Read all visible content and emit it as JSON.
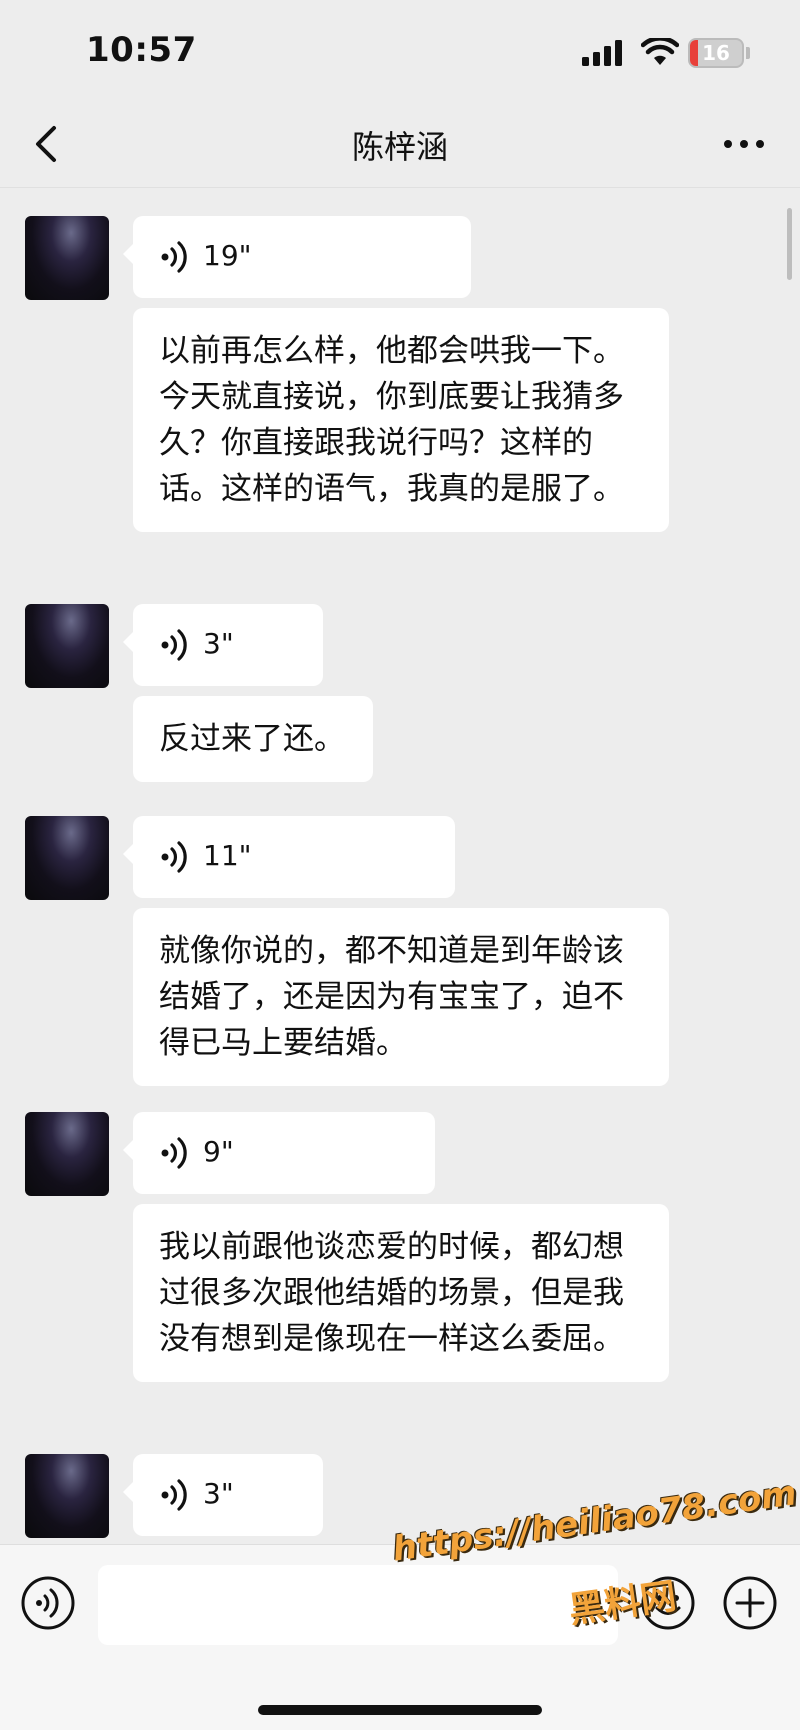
{
  "status_bar": {
    "time": "10:57",
    "battery_level": "16",
    "battery_color": "#e8403a",
    "icons": [
      "cellular-signal-icon",
      "wifi-icon",
      "battery-icon"
    ]
  },
  "nav": {
    "title": "陈梓涵",
    "back_icon": "chevron-left-icon",
    "more_icon": "more-dots-icon"
  },
  "messages": [
    {
      "type": "voice",
      "duration": "19\""
    },
    {
      "type": "text",
      "text": "以前再怎么样，他都会哄我一下。今天就直接说，你到底要让我猜多久？你直接跟我说行吗？这样的话。这样的语气，我真的是服了。"
    },
    {
      "type": "voice",
      "duration": "3\""
    },
    {
      "type": "text",
      "text": "反过来了还。"
    },
    {
      "type": "voice",
      "duration": "11\""
    },
    {
      "type": "text",
      "text": "就像你说的，都不知道是到年龄该结婚了，还是因为有宝宝了，迫不得已马上要结婚。"
    },
    {
      "type": "voice",
      "duration": "9\""
    },
    {
      "type": "text",
      "text": "我以前跟他谈恋爱的时候，都幻想过很多次跟他结婚的场景，但是我没有想到是像现在一样这么委屈。"
    },
    {
      "type": "voice",
      "duration": "3\""
    }
  ],
  "input_bar": {
    "value": "",
    "icons": [
      "voice-input-icon",
      "emoji-icon",
      "plus-icon"
    ]
  },
  "watermark": {
    "url": "https://heiliao78.com",
    "text": "黑料网",
    "color": "#f2a33a"
  },
  "colors": {
    "background": "#ededed",
    "bubble": "#ffffff"
  }
}
